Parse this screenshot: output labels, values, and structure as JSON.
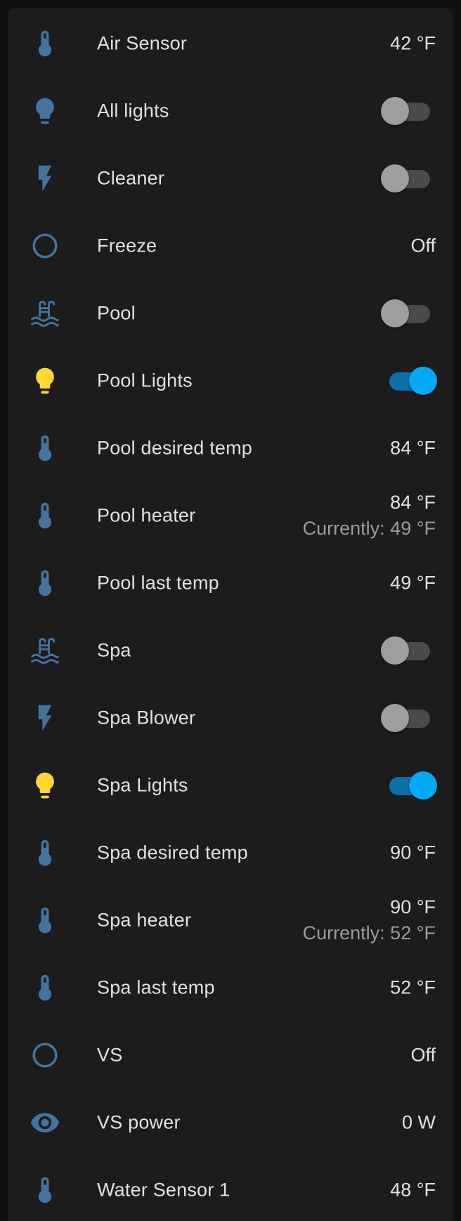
{
  "colors": {
    "background": "#111111",
    "card": "#1c1c1c",
    "icon_default": "#44739e",
    "icon_on": "#fdd835",
    "toggle_on": "#03a9f4",
    "toggle_off_thumb": "#9e9e9e",
    "text_primary": "#e1e1e1",
    "text_secondary": "#9b9b9b"
  },
  "entities": [
    {
      "icon": "thermometer-icon",
      "name": "Air Sensor",
      "value": "42 °F"
    },
    {
      "icon": "lightbulb-icon",
      "name": "All lights",
      "toggle": false
    },
    {
      "icon": "flash-icon",
      "name": "Cleaner",
      "toggle": false
    },
    {
      "icon": "circle-outline-icon",
      "name": "Freeze",
      "value": "Off"
    },
    {
      "icon": "pool-icon",
      "name": "Pool",
      "toggle": false
    },
    {
      "icon": "lightbulb-icon",
      "name": "Pool Lights",
      "toggle": true
    },
    {
      "icon": "thermometer-icon",
      "name": "Pool desired temp",
      "value": "84 °F"
    },
    {
      "icon": "thermometer-icon",
      "name": "Pool heater",
      "value": "84 °F",
      "secondary": "Currently: 49 °F"
    },
    {
      "icon": "thermometer-icon",
      "name": "Pool last temp",
      "value": "49 °F"
    },
    {
      "icon": "pool-icon",
      "name": "Spa",
      "toggle": false
    },
    {
      "icon": "flash-icon",
      "name": "Spa Blower",
      "toggle": false
    },
    {
      "icon": "lightbulb-icon",
      "name": "Spa Lights",
      "toggle": true
    },
    {
      "icon": "thermometer-icon",
      "name": "Spa desired temp",
      "value": "90 °F"
    },
    {
      "icon": "thermometer-icon",
      "name": "Spa heater",
      "value": "90 °F",
      "secondary": "Currently: 52 °F"
    },
    {
      "icon": "thermometer-icon",
      "name": "Spa last temp",
      "value": "52 °F"
    },
    {
      "icon": "circle-outline-icon",
      "name": "VS",
      "value": "Off"
    },
    {
      "icon": "eye-icon",
      "name": "VS power",
      "value": "0 W"
    },
    {
      "icon": "thermometer-icon",
      "name": "Water Sensor 1",
      "value": "48 °F"
    }
  ]
}
